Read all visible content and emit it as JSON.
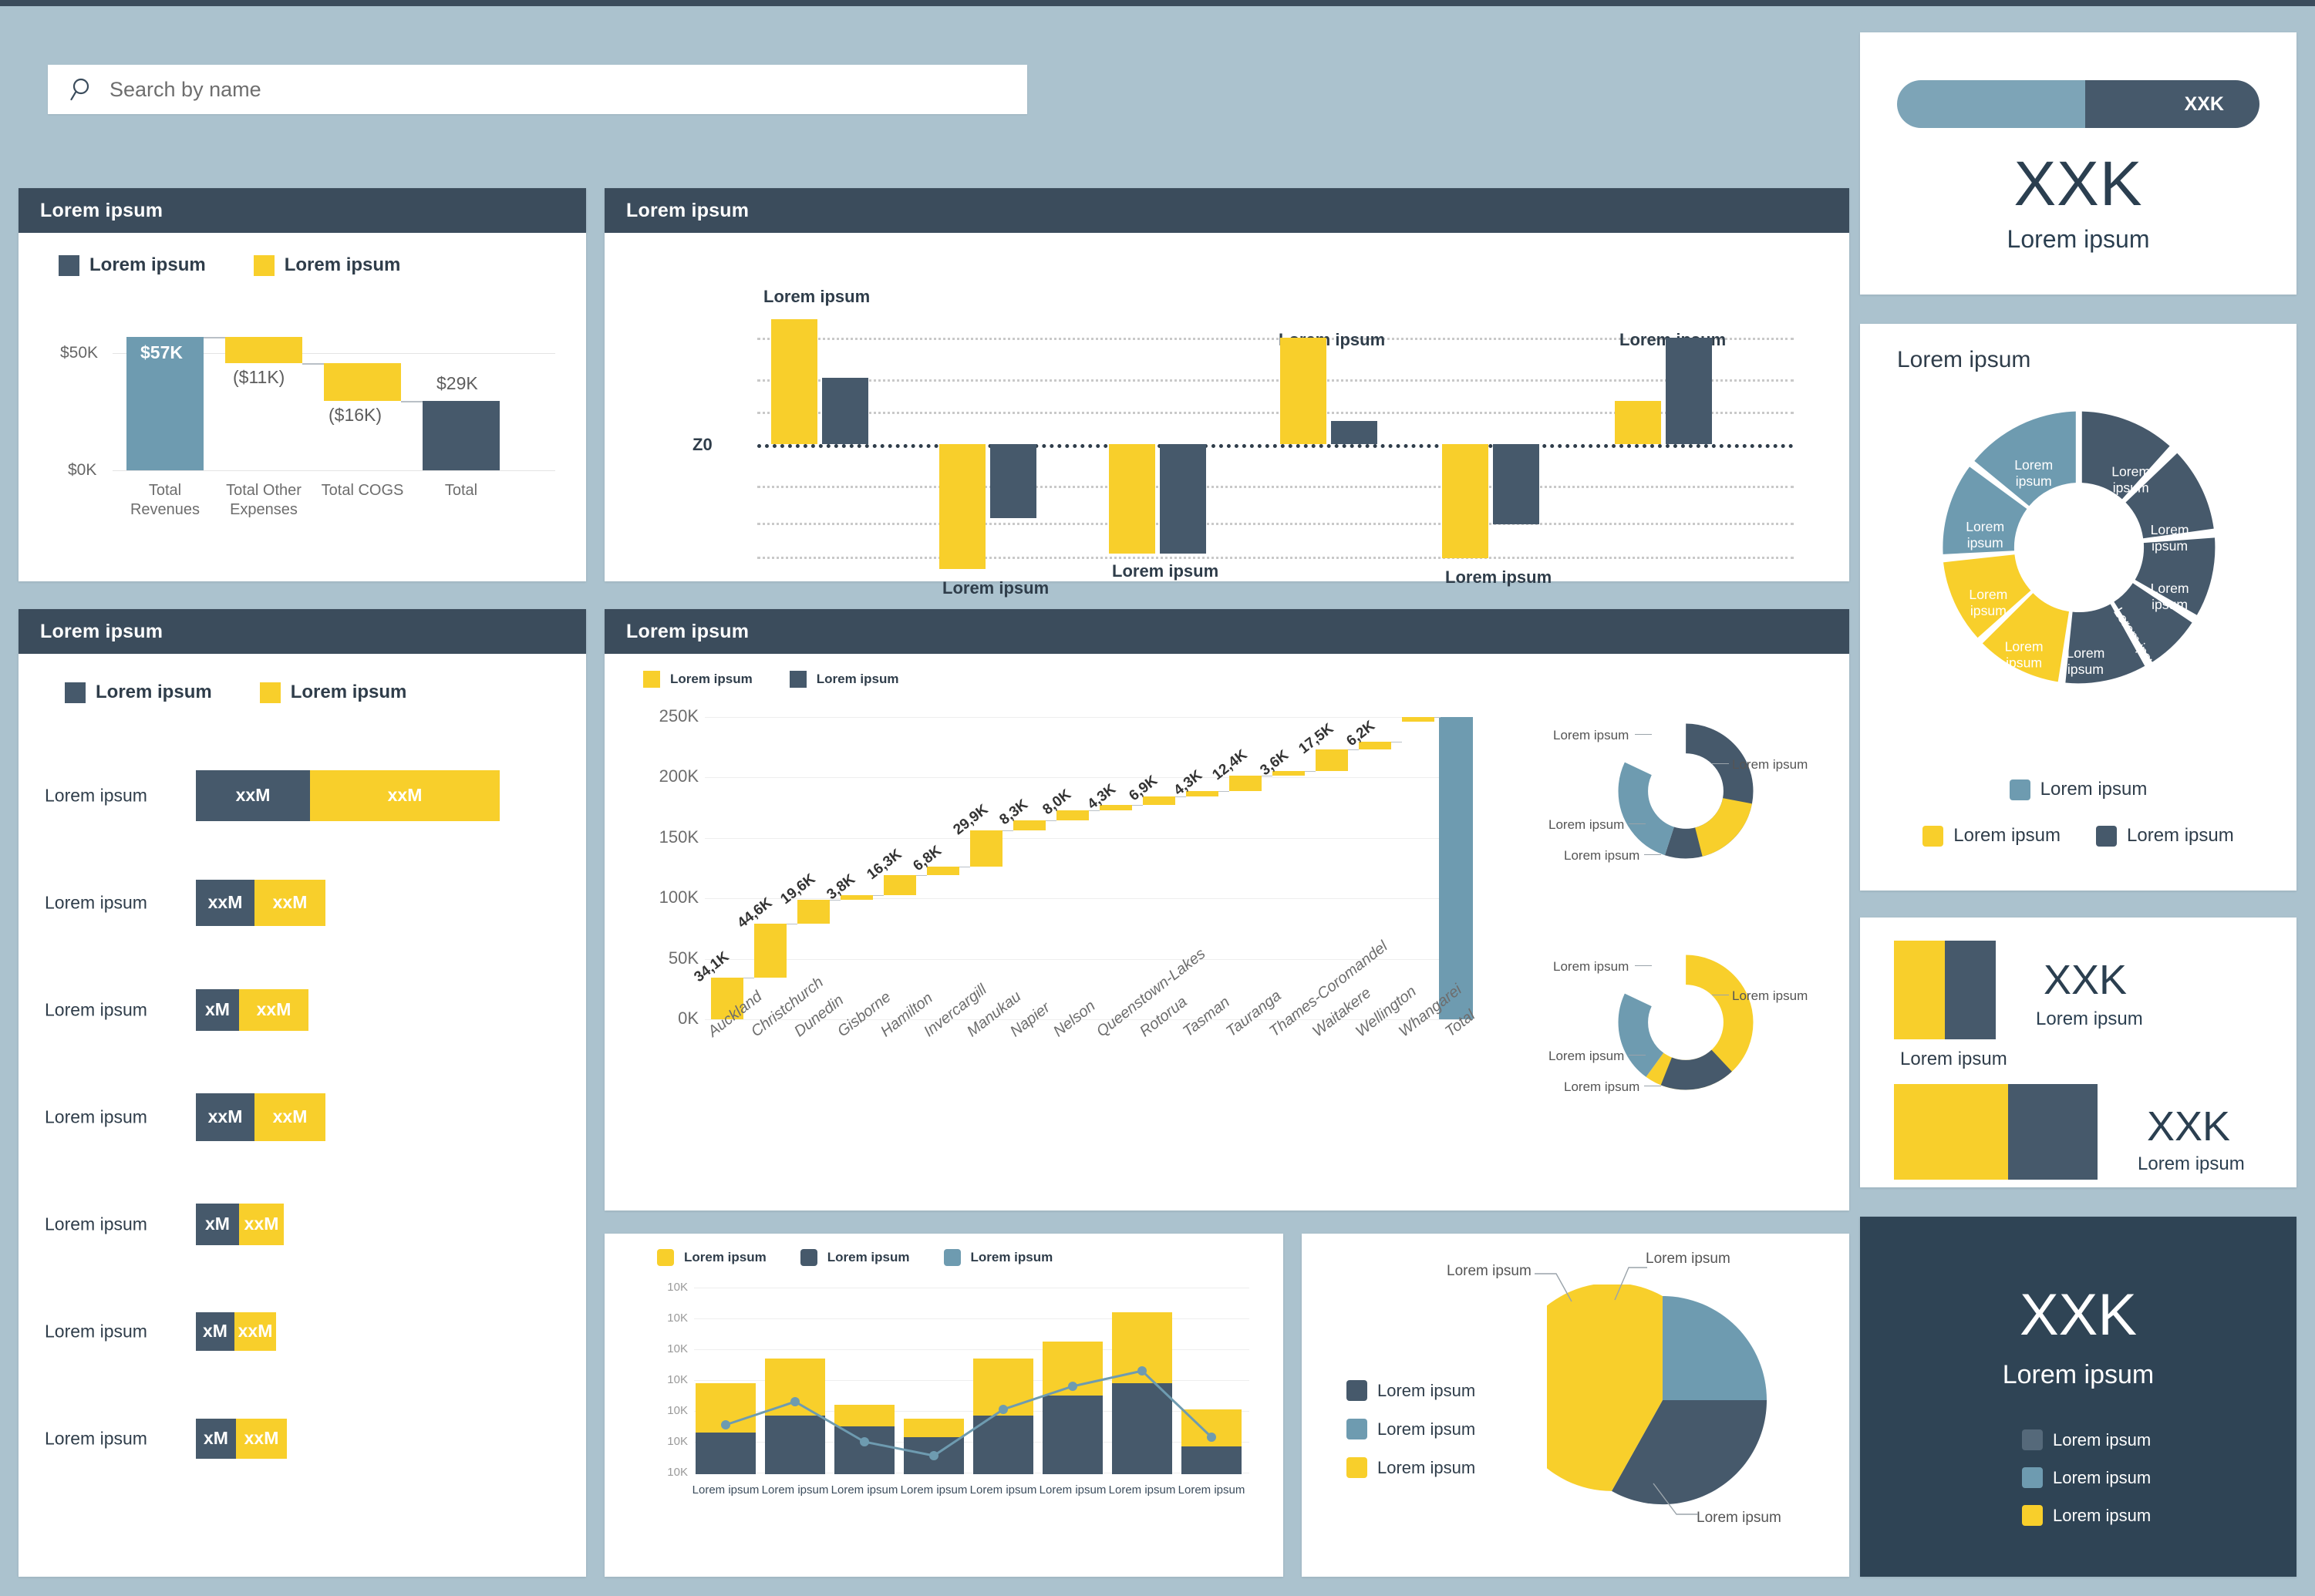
{
  "theme": {
    "background": "#abc2ce",
    "card_bg": "#ffffff",
    "header_bg": "#3b4c5c",
    "navy": "#46596b",
    "teal": "#6e9bb0",
    "yellow": "#f8cf2b",
    "dark_card": "#2f4455"
  },
  "search": {
    "placeholder": "Search by name",
    "icon": "search-icon"
  },
  "cards": {
    "revenue": {
      "title": "Lorem ipsum"
    },
    "diverging": {
      "title": "Lorem ipsum"
    },
    "hbars": {
      "title": "Lorem ipsum"
    },
    "cities": {
      "title": "Lorem ipsum"
    }
  },
  "legends": {
    "navy_label": "Lorem ipsum",
    "yellow_label": "Lorem ipsum",
    "teal_label": "Lorem ipsum"
  },
  "kpi_bar": {
    "pill_value": "XXK",
    "big_value": "XXK",
    "subtitle": "Lorem ipsum"
  },
  "donut8": {
    "title": "Lorem ipsum",
    "segment_label": "Lorem ipsum",
    "legend_teal": "Lorem ipsum",
    "legend_yellow": "Lorem ipsum",
    "legend_navy": "Lorem ipsum"
  },
  "kpi2": {
    "first_value": "XXK",
    "first_sub": "Lorem ipsum",
    "first_caption": "Lorem ipsum",
    "second_value": "XXK",
    "second_sub": "Lorem ipsum"
  },
  "dark_card": {
    "big_value": "XXK",
    "subtitle": "Lorem ipsum",
    "legend": [
      "Lorem ipsum",
      "Lorem ipsum",
      "Lorem ipsum"
    ]
  },
  "chart_data": [
    {
      "id": "revenue_waterfall",
      "type": "bar",
      "title": "Lorem ipsum",
      "categories": [
        "Total Revenues",
        "Total Other Expenses",
        "Total COGS",
        "Total"
      ],
      "values": [
        57,
        -11,
        -16,
        29
      ],
      "value_labels": [
        "$57K",
        "($11K)",
        "($16K)",
        "$29K"
      ],
      "bar_colors": [
        "#6e9bb0",
        "#f8cf2b",
        "#f8cf2b",
        "#46596b"
      ],
      "ylabel": "",
      "yticks": [
        "$50K",
        "$0K"
      ],
      "ytick_values": [
        50,
        0
      ],
      "ylim": [
        0,
        60
      ],
      "grid": true,
      "legend": [
        "Lorem ipsum",
        "Lorem ipsum"
      ]
    },
    {
      "id": "diverging_columns",
      "type": "bar",
      "title": "Lorem ipsum",
      "zero_label": "Z0",
      "categories": [
        "Lorem ipsum",
        "Lorem ipsum",
        "Lorem ipsum",
        "Lorem ipsum",
        "Lorem ipsum"
      ],
      "series": [
        {
          "name": "Lorem ipsum",
          "color": "#f8cf2b",
          "values": [
            92,
            -110,
            -95,
            82,
            42
          ]
        },
        {
          "name": "Lorem ipsum",
          "color": "#46596b",
          "values": [
            47,
            -40,
            -95,
            16,
            88
          ]
        }
      ],
      "ylim": [
        -120,
        100
      ],
      "gridlines": [
        90,
        45,
        22,
        0,
        -40,
        -75,
        -112
      ],
      "grid": true
    },
    {
      "id": "horizontal_stacked",
      "type": "bar",
      "title": "Lorem ipsum",
      "orientation": "horizontal",
      "legend": [
        "Lorem ipsum",
        "Lorem ipsum"
      ],
      "categories": [
        "Lorem ipsum",
        "Lorem ipsum",
        "Lorem ipsum",
        "Lorem ipsum",
        "Lorem ipsum",
        "Lorem ipsum",
        "Lorem ipsum"
      ],
      "series": [
        {
          "name": "Lorem ipsum",
          "color": "#46596b",
          "values": [
            88,
            66,
            47,
            66,
            50,
            45,
            48
          ],
          "labels": [
            "xxM",
            "xxM",
            "xM",
            "xxM",
            "xM",
            "xM",
            "xM"
          ]
        },
        {
          "name": "Lorem ipsum",
          "color": "#f8cf2b",
          "values": [
            146,
            78,
            44,
            78,
            50,
            50,
            62
          ],
          "labels": [
            "xxM",
            "xxM",
            "xxM",
            "xxM",
            "xxM",
            "xxM",
            "xxM"
          ]
        }
      ]
    },
    {
      "id": "cities_waterfall",
      "type": "bar",
      "title": "Lorem ipsum",
      "legend": [
        "Lorem ipsum",
        "Lorem ipsum"
      ],
      "categories": [
        "Auckland",
        "Christchurch",
        "Dunedin",
        "Gisborne",
        "Hamilton",
        "Invercargill",
        "Manukau",
        "Napier",
        "Nelson",
        "Queenstown-Lakes",
        "Rotorua",
        "Tasman",
        "Tauranga",
        "Thames-Coromandel",
        "Waitakere",
        "Wellington",
        "Whangarei",
        "Total"
      ],
      "values": [
        34.1,
        44.6,
        19.6,
        3.8,
        16.3,
        6.8,
        29.9,
        8.3,
        8.0,
        4.3,
        6.9,
        4.3,
        12.4,
        3.6,
        17.5,
        6.2,
        2.0,
        248.6
      ],
      "value_labels": [
        "34,1K",
        "44,6K",
        "19,6K",
        "3,8K",
        "16,3K",
        "6,8K",
        "29,9K",
        "8,3K",
        "8,0K",
        "4,3K",
        "6,9K",
        "4,3K",
        "12,4K",
        "3,6K",
        "17,5K",
        "6,2K",
        "",
        ""
      ],
      "yticks": [
        "250K",
        "200K",
        "150K",
        "100K",
        "50K",
        "0K"
      ],
      "ytick_values": [
        250,
        200,
        150,
        100,
        50,
        0
      ],
      "ylim": [
        0,
        260
      ],
      "ylabel": "",
      "grid": true,
      "bar_color": "#f8cf2b",
      "total_color": "#6e9bb0"
    },
    {
      "id": "donut_small_1",
      "type": "pie",
      "labels": [
        "Lorem ipsum",
        "Lorem ipsum",
        "Lorem ipsum",
        "Lorem ipsum"
      ],
      "values": [
        55,
        19,
        8,
        18
      ],
      "colors": [
        "#46596b",
        "#6e9bb0",
        "#6e9bb0",
        "#f8cf2b"
      ]
    },
    {
      "id": "donut_small_2",
      "type": "pie",
      "labels": [
        "Lorem ipsum",
        "Lorem ipsum",
        "Lorem ipsum",
        "Lorem ipsum"
      ],
      "values": [
        60,
        11,
        11,
        18
      ],
      "colors": [
        "#f8cf2b",
        "#6e9bb0",
        "#6e9bb0",
        "#46596b"
      ]
    },
    {
      "id": "combo_bar_line",
      "type": "bar",
      "title": "Lorem ipsum",
      "legend": [
        "Lorem ipsum",
        "Lorem ipsum",
        "Lorem ipsum"
      ],
      "categories": [
        "Lorem ipsum",
        "Lorem ipsum",
        "Lorem ipsum",
        "Lorem ipsum",
        "Lorem ipsum",
        "Lorem ipsum",
        "Lorem ipsum",
        "Lorem ipsum"
      ],
      "series": [
        {
          "name": "Lorem ipsum",
          "color": "#46596b",
          "values": [
            22,
            42,
            15,
            10,
            42,
            62,
            80,
            14
          ]
        },
        {
          "name": "Lorem ipsum",
          "color": "#f8cf2b",
          "values": [
            36,
            50,
            14,
            12,
            46,
            38,
            65,
            22
          ]
        },
        {
          "name": "Lorem ipsum",
          "color": "#6e9bb0",
          "type": "line",
          "values": [
            38,
            72,
            32,
            18,
            60,
            72,
            94,
            27
          ]
        }
      ],
      "yticks": [
        "10K",
        "10K",
        "10K",
        "10K",
        "10K",
        "10K",
        "10K"
      ],
      "ylim": [
        0,
        170
      ],
      "grid": true
    },
    {
      "id": "pie_main",
      "type": "pie",
      "labels": [
        "Lorem ipsum",
        "Lorem ipsum",
        "Lorem ipsum"
      ],
      "legend": [
        "Lorem ipsum",
        "Lorem ipsum",
        "Lorem ipsum"
      ],
      "values": [
        25,
        33,
        42
      ],
      "colors": [
        "#6e9bb0",
        "#46596b",
        "#f8cf2b"
      ]
    },
    {
      "id": "donut_segmented_8",
      "type": "pie",
      "title": "Lorem ipsum",
      "labels": [
        "Lorem ipsum",
        "Lorem ipsum",
        "Lorem ipsum",
        "Lorem ipsum",
        "Lorem ipsum",
        "Lorem ipsum",
        "Lorem ipsum",
        "Lorem ipsum"
      ],
      "values": [
        13,
        14,
        10,
        7,
        12,
        12,
        11,
        13
      ],
      "colors": [
        "#46596b",
        "#46596b",
        "#46596b",
        "#46596b",
        "#46596b",
        "#f8cf2b",
        "#f8cf2b",
        "#6e9bb0"
      ],
      "legend": [
        "Lorem ipsum",
        "Lorem ipsum",
        "Lorem ipsum"
      ]
    },
    {
      "id": "kpi_progress",
      "type": "bar",
      "values": [
        52,
        48
      ],
      "value_label": "XXK",
      "colors": [
        "#7da4b7",
        "#46596b"
      ]
    }
  ]
}
